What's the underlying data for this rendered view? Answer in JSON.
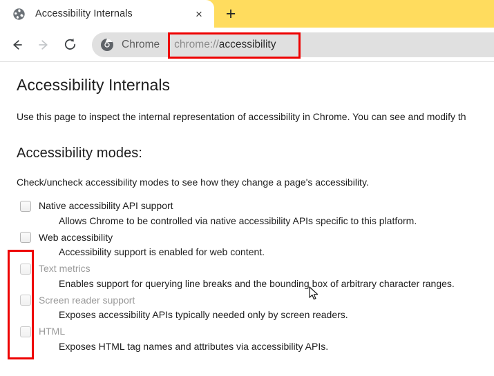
{
  "browser": {
    "tab": {
      "favicon": "globe-icon",
      "title": "Accessibility Internals",
      "close_label": "×"
    },
    "newtab_label": "+",
    "toolbar": {
      "back_label": "←",
      "forward_label": "→",
      "reload_label": "⟳",
      "omnibox": {
        "chrome_icon": "chrome-logo-icon",
        "chrome_label": "Chrome",
        "url_scheme": "chrome://",
        "url_host": "accessibility",
        "full_url": "chrome://accessibility"
      }
    },
    "colors": {
      "tabstrip_background": "#ffdc5e",
      "omnibox_background": "#e0e0e0",
      "annotation_red": "#ee0000",
      "toolbar_background": "#ffffff"
    }
  },
  "page": {
    "title": "Accessibility Internals",
    "intro": "Use this page to inspect the internal representation of accessibility in Chrome. You can see and modify th",
    "section_title": "Accessibility modes:",
    "section_intro": "Check/uncheck accessibility modes to see how they change a page's accessibility.",
    "modes": [
      {
        "label": "Native accessibility API support",
        "description": "Allows Chrome to be controlled via native accessibility APIs specific to this platform.",
        "checked": false,
        "disabled": false
      },
      {
        "label": "Web accessibility",
        "description": "Accessibility support is enabled for web content.",
        "checked": false,
        "disabled": false
      },
      {
        "label": "Text metrics",
        "description": "Enables support for querying line breaks and the bounding box of arbitrary character ranges.",
        "checked": false,
        "disabled": true
      },
      {
        "label": "Screen reader support",
        "description": "Exposes accessibility APIs typically needed only by screen readers.",
        "checked": false,
        "disabled": true
      },
      {
        "label": "HTML",
        "description": "Exposes HTML tag names and attributes via accessibility APIs.",
        "checked": false,
        "disabled": true
      }
    ]
  },
  "annotations": [
    {
      "name": "url-highlight",
      "target": "chrome://accessibility"
    },
    {
      "name": "disabled-modes-highlight",
      "target": "checkbox column"
    }
  ]
}
